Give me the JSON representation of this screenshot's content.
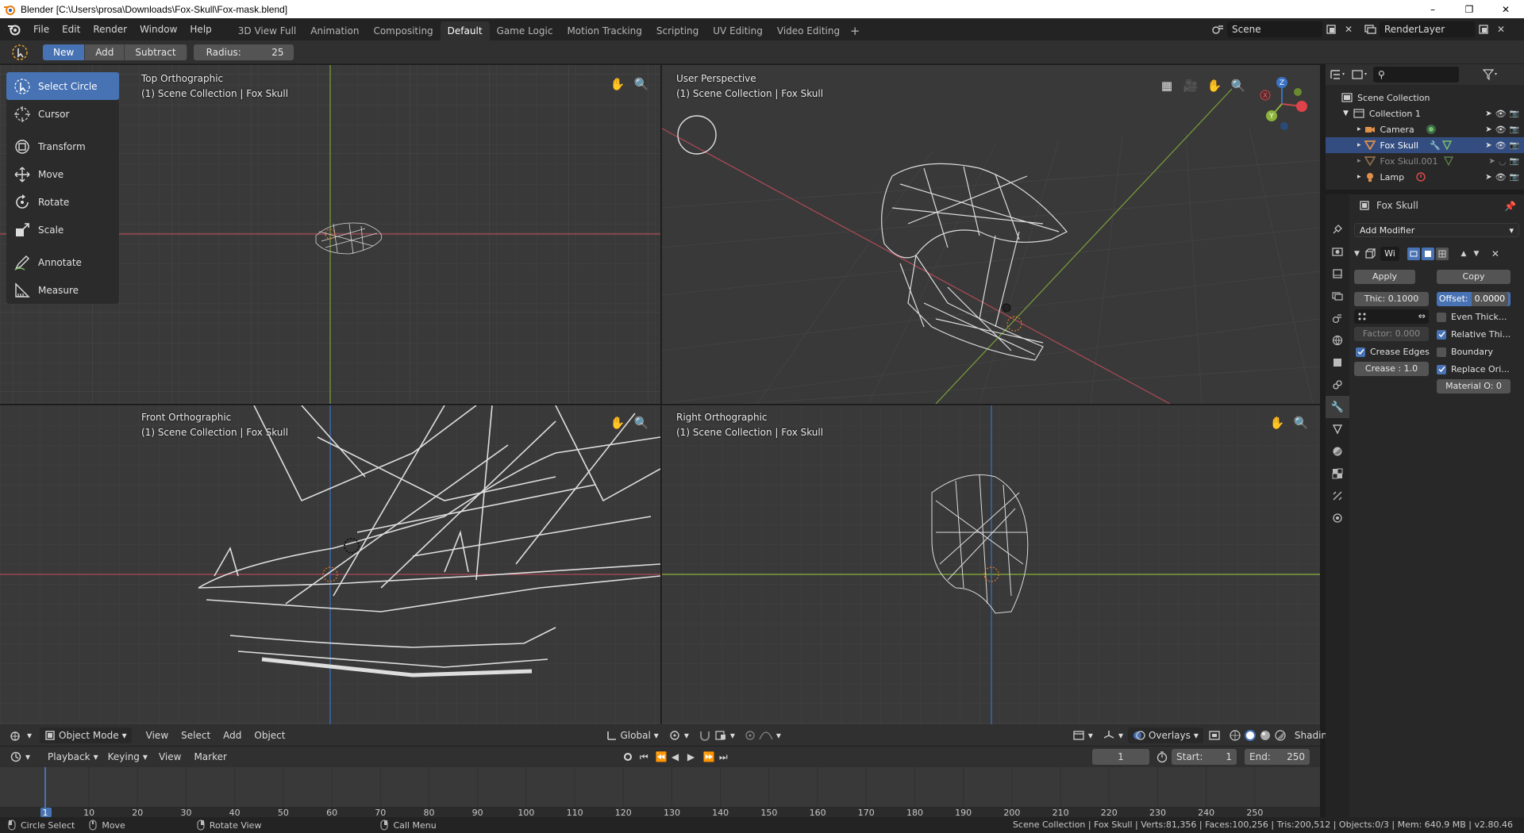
{
  "window": {
    "title": "Blender [C:\\Users\\prosa\\Downloads\\Fox-Skull\\Fox-mask.blend]",
    "controls": [
      "–",
      "❐",
      "✕"
    ]
  },
  "menu": [
    "File",
    "Edit",
    "Render",
    "Window",
    "Help"
  ],
  "workspaces": [
    {
      "label": "3D View Full",
      "active": false
    },
    {
      "label": "Animation",
      "active": false
    },
    {
      "label": "Compositing",
      "active": false
    },
    {
      "label": "Default",
      "active": true
    },
    {
      "label": "Game Logic",
      "active": false
    },
    {
      "label": "Motion Tracking",
      "active": false
    },
    {
      "label": "Scripting",
      "active": false
    },
    {
      "label": "UV Editing",
      "active": false
    },
    {
      "label": "Video Editing",
      "active": false
    }
  ],
  "workspace_add": "+",
  "scene": {
    "name": "Scene",
    "render_layer": "RenderLayer"
  },
  "tool_header": {
    "modes": [
      "New",
      "Add",
      "Subtract"
    ],
    "active_mode": "New",
    "radius_label": "Radius:",
    "radius_value": "25"
  },
  "toolbar": [
    {
      "label": "Select Circle",
      "icon": "select-circle-icon",
      "active": true
    },
    {
      "label": "Cursor",
      "icon": "cursor-icon",
      "active": false
    },
    {
      "label": "Transform",
      "icon": "transform-icon",
      "active": false
    },
    {
      "label": "Move",
      "icon": "move-icon",
      "active": false
    },
    {
      "label": "Rotate",
      "icon": "rotate-icon",
      "active": false
    },
    {
      "label": "Scale",
      "icon": "scale-icon",
      "active": false
    },
    {
      "label": "Annotate",
      "icon": "annotate-icon",
      "active": false
    },
    {
      "label": "Measure",
      "icon": "measure-icon",
      "active": false
    }
  ],
  "viewports": {
    "top": {
      "view": "Top Orthographic",
      "collection": "(1) Scene Collection | Fox Skull"
    },
    "user": {
      "view": "User Perspective",
      "collection": "(1) Scene Collection | Fox Skull"
    },
    "front": {
      "view": "Front Orthographic",
      "collection": "(1) Scene Collection | Fox Skull"
    },
    "right": {
      "view": "Right Orthographic",
      "collection": "(1) Scene Collection | Fox Skull"
    }
  },
  "viewport_header": {
    "mode": "Object Mode",
    "menus": [
      "View",
      "Select",
      "Add",
      "Object"
    ],
    "orientation": "Global",
    "overlays": "Overlays",
    "shading": "Shading"
  },
  "timeline": {
    "menus": [
      "Playback",
      "Keying",
      "View",
      "Marker"
    ],
    "current_frame": "1",
    "start_label": "Start:",
    "start": "1",
    "end_label": "End:",
    "end": "250",
    "ruler": [
      "1",
      "10",
      "20",
      "30",
      "40",
      "50",
      "60",
      "70",
      "80",
      "90",
      "100",
      "110",
      "120",
      "130",
      "140",
      "150",
      "160",
      "170",
      "180",
      "190",
      "200",
      "210",
      "220",
      "230",
      "240",
      "250"
    ]
  },
  "status": {
    "left": [
      "Circle Select",
      "Move",
      "Rotate View",
      "Call Menu"
    ],
    "right": "Scene Collection | Fox Skull | Verts:81,356 | Faces:100,256 | Tris:200,512 | Objects:0/3 | Mem: 640.9 MB | v2.80.46"
  },
  "outliner": {
    "root": "Scene Collection",
    "collection": "Collection 1",
    "items": [
      {
        "name": "Camera",
        "icon": "camera-icon",
        "selected": false,
        "dim": false
      },
      {
        "name": "Fox Skull",
        "icon": "mesh-icon",
        "selected": true,
        "dim": false
      },
      {
        "name": "Fox Skull.001",
        "icon": "mesh-icon",
        "selected": false,
        "dim": true
      },
      {
        "name": "Lamp",
        "icon": "light-icon",
        "selected": false,
        "dim": false
      }
    ]
  },
  "properties": {
    "object_name": "Fox Skull",
    "add_modifier": "Add Modifier",
    "modifier_name": "Wi",
    "apply": "Apply",
    "copy": "Copy",
    "thickness": "Thic: 0.1000",
    "offset_label": "Offset:",
    "offset_value": "0.0000",
    "factor": "Factor:   0.000",
    "crease": "Crease :  1.0",
    "material_offset": "Material O: 0",
    "checks": [
      {
        "label": "Even Thick...",
        "checked": false
      },
      {
        "label": "Relative Thi...",
        "checked": true
      },
      {
        "label": "Crease Edges",
        "checked": true
      },
      {
        "label": "Boundary",
        "checked": false
      },
      {
        "label": "Replace Ori...",
        "checked": true
      }
    ]
  },
  "colors": {
    "accent": "#4772b3",
    "axis_x": "#c44a4a",
    "axis_y": "#8bb33a",
    "axis_z": "#3a72c4"
  }
}
